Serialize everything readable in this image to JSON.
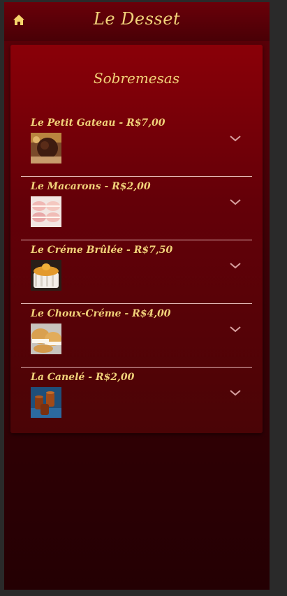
{
  "header": {
    "title": "Le Desset",
    "home_icon": "home-icon"
  },
  "section": {
    "title": "Sobremesas"
  },
  "items": [
    {
      "label": "Le Petit Gateau - R$7,00",
      "image": "petit-gateau-image"
    },
    {
      "label": "Le Macarons - R$2,00",
      "image": "macarons-image"
    },
    {
      "label": "Le Créme Brûlée - R$7,50",
      "image": "creme-brulee-image"
    },
    {
      "label": "Le Choux-Créme - R$4,00",
      "image": "choux-creme-image"
    },
    {
      "label": "La Canelé - R$2,00",
      "image": "canele-image"
    }
  ],
  "colors": {
    "accent": "#f1d27a",
    "background": "#5e0008",
    "card": "#8a0008",
    "divider": "#e6b8b8"
  }
}
